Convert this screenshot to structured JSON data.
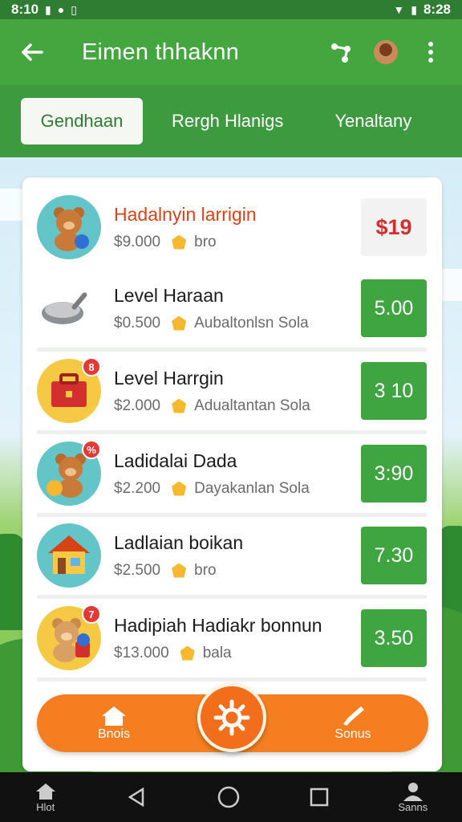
{
  "status_bar": {
    "time_left": "8:10",
    "time_right": "8:28"
  },
  "app_bar": {
    "title": "Eimen thhaknn"
  },
  "tabs": [
    {
      "label": "Gendhaan",
      "active": true
    },
    {
      "label": "Rergh Hlanigs",
      "active": false
    },
    {
      "label": "Yenaltany",
      "active": false
    }
  ],
  "items": [
    {
      "title": "Hadalnyin larrigin",
      "amount": "$9.000",
      "tag": "bro",
      "price": "$19",
      "thumb": "bear-with-coin",
      "badge": ""
    },
    {
      "title": "Level Haraan",
      "amount": "$0.500",
      "tag": "Aubaltonlsn Sola",
      "price": "5.00",
      "thumb": "frying-pan",
      "badge": ""
    },
    {
      "title": "Level Harrgin",
      "amount": "$2.000",
      "tag": "Adualtantan Sola",
      "price": "3 10",
      "thumb": "toolbox",
      "badge": "8"
    },
    {
      "title": "Ladidalai Dada",
      "amount": "$2.200",
      "tag": "Dayakanlan Sola",
      "price": "3:90",
      "thumb": "bear-with-coins",
      "badge": "%"
    },
    {
      "title": "Ladlaian boikan",
      "amount": "$2.500",
      "tag": "bro",
      "price": "7.30",
      "thumb": "house",
      "badge": ""
    },
    {
      "title": "Hadipiah Hadiakr bonnun",
      "amount": "$13.000",
      "tag": "bala",
      "price": "3.50",
      "thumb": "bear-with-gift",
      "badge": "7"
    }
  ],
  "action_bar": {
    "left_label": "Bnois",
    "right_label": "Sonus"
  },
  "nav_bar": {
    "home_label": "Hlot",
    "profile_label": "Sanns"
  },
  "colors": {
    "primary": "#43a63f",
    "accent": "#f57f20",
    "price_red": "#d32f2f"
  }
}
